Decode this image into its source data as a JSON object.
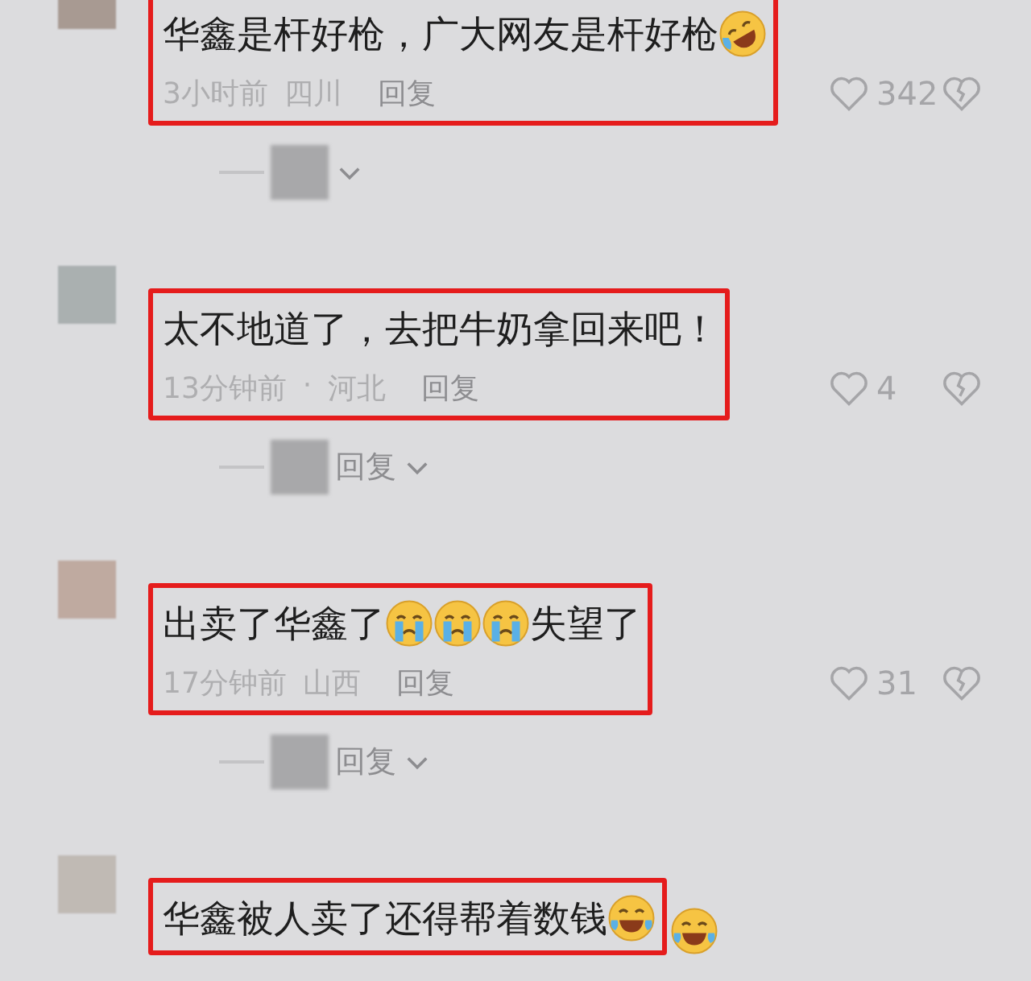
{
  "comments": [
    {
      "avatar": {
        "color": "#a89a92"
      },
      "highlighted": true,
      "content": [
        {
          "kind": "text",
          "text": "华鑫是杆好枪，广大网友是杆好枪"
        },
        {
          "kind": "rofl"
        }
      ],
      "meta": {
        "time": "3小时前",
        "location": "四川",
        "reply": "回复"
      },
      "likes": "342",
      "expand": true
    },
    {
      "avatar": {
        "color": "#aab0b0"
      },
      "highlighted": true,
      "content": [
        {
          "kind": "text",
          "text": "太不地道了，去把牛奶拿回来吧！"
        }
      ],
      "meta": {
        "time": "13分钟前",
        "separator": "·",
        "location": "河北",
        "reply": "回复"
      },
      "likes": "4",
      "expand": true,
      "expand_label": "回复"
    },
    {
      "avatar": {
        "color": "#bfaaa0"
      },
      "highlighted": true,
      "content": [
        {
          "kind": "text",
          "text": "出卖了华鑫了"
        },
        {
          "kind": "crying"
        },
        {
          "kind": "crying"
        },
        {
          "kind": "crying"
        },
        {
          "kind": "text",
          "text": "失望了"
        }
      ],
      "meta": {
        "time": "17分钟前",
        "location": "山西",
        "reply": "回复"
      },
      "likes": "31",
      "expand": true,
      "expand_label": "回复"
    },
    {
      "avatar": {
        "color": "#c0bab4"
      },
      "highlighted": true,
      "content": [
        {
          "kind": "text",
          "text": "华鑫被人卖了还得帮着数钱"
        },
        {
          "kind": "laughing"
        }
      ],
      "after": [
        {
          "kind": "laughing"
        }
      ]
    }
  ]
}
